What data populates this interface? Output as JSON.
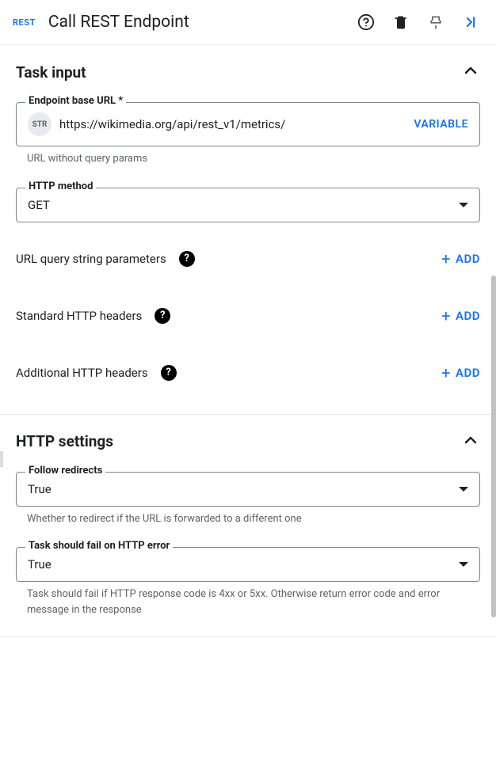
{
  "header": {
    "badge": "REST",
    "title": "Call REST Endpoint"
  },
  "task_input": {
    "title": "Task input",
    "endpoint": {
      "label": "Endpoint base URL *",
      "type_badge": "STR",
      "value": "https://wikimedia.org/api/rest_v1/metrics/",
      "variable_btn": "VARIABLE",
      "helper": "URL without query params"
    },
    "http_method": {
      "label": "HTTP method",
      "value": "GET"
    },
    "rows": [
      {
        "label": "URL query string parameters",
        "add": "ADD"
      },
      {
        "label": "Standard HTTP headers",
        "add": "ADD"
      },
      {
        "label": "Additional HTTP headers",
        "add": "ADD"
      }
    ]
  },
  "http_settings": {
    "title": "HTTP settings",
    "follow_redirects": {
      "label": "Follow redirects",
      "value": "True",
      "helper": "Whether to redirect if the URL is forwarded to a different one"
    },
    "fail_on_error": {
      "label": "Task should fail on HTTP error",
      "value": "True",
      "helper": "Task should fail if HTTP response code is 4xx or 5xx. Otherwise return error code and error message in the response"
    }
  }
}
